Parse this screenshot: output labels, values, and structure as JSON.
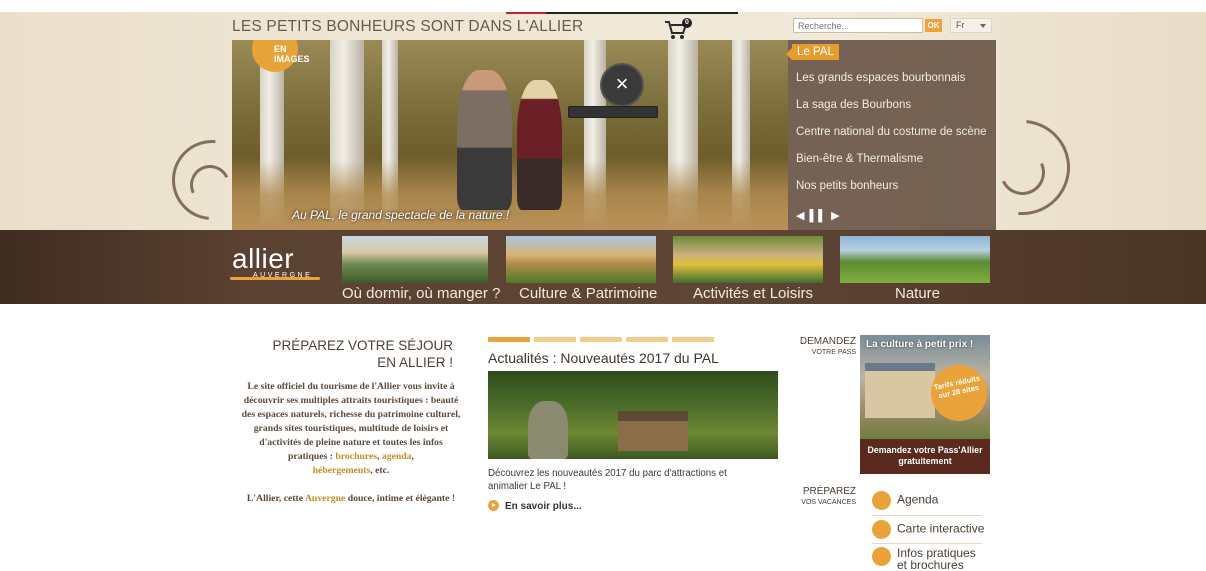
{
  "header": {
    "tagline": "LES PETITS BONHEURS SONT DANS L'ALLIER",
    "cart_count": "0",
    "search_placeholder": "Recherche...",
    "search_button": "OK",
    "language": "Fr"
  },
  "hero": {
    "badge_text": "EN IMAGES",
    "caption": "Au PAL, le grand spectacle de la nature !",
    "close_symbol": "×"
  },
  "slider_menu": {
    "items": [
      {
        "label": "Le PAL",
        "active": true
      },
      {
        "label": "Les grands espaces bourbonnais"
      },
      {
        "label": "La saga des Bourbons"
      },
      {
        "label": "Centre national du costume de scène"
      },
      {
        "label": "Bien-être & Thermalisme"
      },
      {
        "label": "Nos petits bonheurs"
      }
    ],
    "controls": "◀ ▌▌ ▶"
  },
  "brand": {
    "logo_main": "allier",
    "logo_sub": "AUVERGNE"
  },
  "nav": {
    "items": [
      {
        "label": "Où dormir, où manger ?"
      },
      {
        "label": "Culture & Patrimoine"
      },
      {
        "label": "Activités et Loisirs"
      },
      {
        "label": "Nature"
      }
    ]
  },
  "intro": {
    "title": "PRÉPAREZ VOTRE SÉJOUR EN ALLIER !",
    "p1_a": "Le site officiel du tourisme de l'Allier vous invite à découvrir ses multiples attraits touristiques : beauté des espaces naturels, richesse du patrimoine culturel, grands sites touristiques, multitude de loisirs et d'activités de pleine nature et toutes les infos pratiques : ",
    "link_brochures": "brochures",
    "sep1": ", ",
    "link_agenda": "agenda",
    "sep2": ", ",
    "link_hebergements": "hébergements",
    "p1_end": ", etc.",
    "p2_a": "L'Allier, cette ",
    "link_auvergne": "Auvergne",
    "p2_end": " douce, intime et élégante !"
  },
  "news": {
    "title": "Actualités : Nouveautés 2017 du PAL",
    "text": "Découvrez les nouveautés 2017 du parc d'attractions et animalier Le PAL !",
    "more": "En savoir plus...",
    "tab_count": 5
  },
  "pass": {
    "label_main": "DEMANDEZ",
    "label_sub": "VOTRE PASS",
    "headline": "La culture à petit prix !",
    "badge": "Tarifs réduits sur 28 sites",
    "cta": "Demandez votre Pass'Allier gratuitement"
  },
  "prepare": {
    "label_main": "PRÉPAREZ",
    "label_sub": "VOS VACANCES",
    "tools": [
      {
        "label": "Agenda",
        "icon": "calendar-icon"
      },
      {
        "label": "Carte interactive",
        "icon": "map-icon"
      },
      {
        "label": "Infos pratiques et brochures",
        "icon": "info-icon"
      }
    ]
  },
  "colors": {
    "accent": "#e8a33b",
    "brown": "#5a4131",
    "beige": "#efe6d6"
  }
}
